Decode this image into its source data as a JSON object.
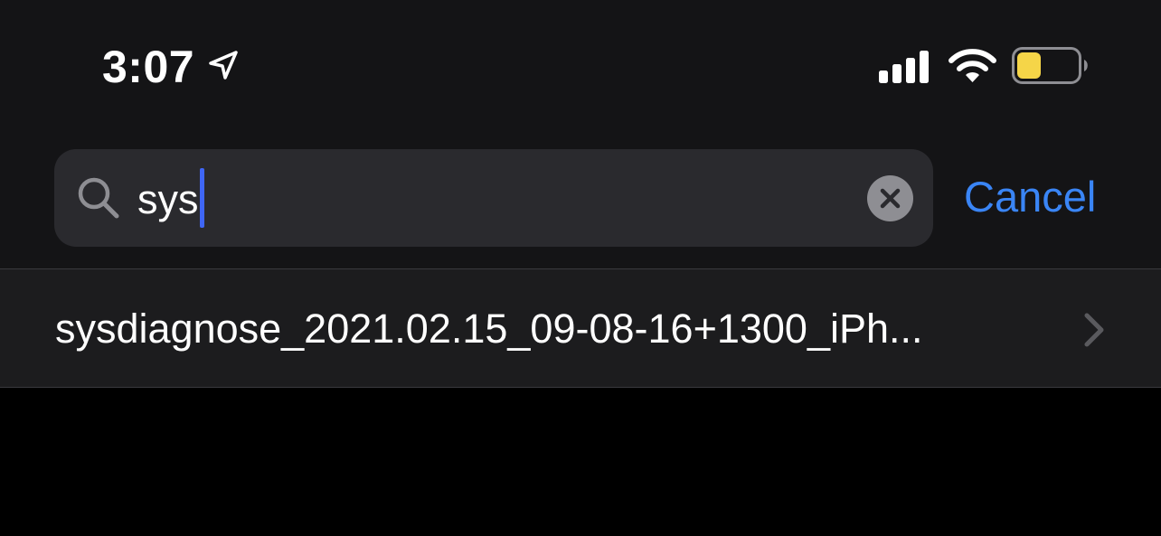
{
  "status_bar": {
    "time": "3:07",
    "location_icon": "location-arrow-icon",
    "signal_icon": "cellular-signal-icon",
    "wifi_icon": "wifi-icon",
    "battery_icon": "battery-icon",
    "battery_level": 0.4,
    "battery_color": "#f5d548"
  },
  "search": {
    "icon": "search-icon",
    "value": "sys",
    "clear_icon": "clear-icon",
    "cancel_label": "Cancel"
  },
  "results": [
    {
      "label": "sysdiagnose_2021.02.15_09-08-16+1300_iPh...",
      "accessory_icon": "chevron-right-icon"
    }
  ],
  "colors": {
    "accent": "#3a85f5",
    "caret": "#3f66f5",
    "field_background": "#2a2a2e",
    "row_background": "#1c1c1e"
  }
}
